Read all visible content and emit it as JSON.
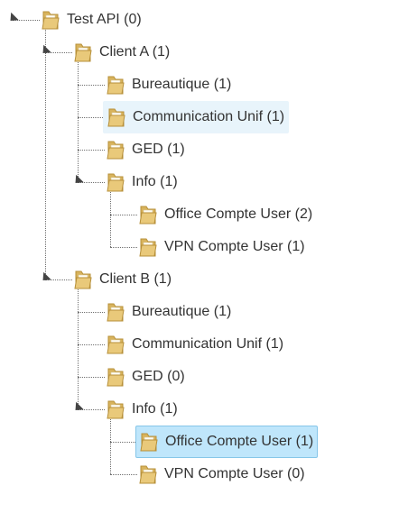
{
  "tree": {
    "label": "Test API (0)",
    "expanded": true,
    "children": [
      {
        "label": "Client A (1)",
        "expanded": true,
        "children": [
          {
            "label": "Bureautique (1)",
            "children": []
          },
          {
            "label": "Communication Unif (1)",
            "state": "hover",
            "children": []
          },
          {
            "label": "GED (1)",
            "children": []
          },
          {
            "label": "Info (1)",
            "expanded": true,
            "children": [
              {
                "label": "Office Compte User (2)",
                "children": []
              },
              {
                "label": "VPN Compte User (1)",
                "children": []
              }
            ]
          }
        ]
      },
      {
        "label": "Client B (1)",
        "expanded": true,
        "children": [
          {
            "label": "Bureautique (1)",
            "children": []
          },
          {
            "label": "Communication Unif (1)",
            "children": []
          },
          {
            "label": "GED (0)",
            "children": []
          },
          {
            "label": "Info (1)",
            "expanded": true,
            "children": [
              {
                "label": "Office Compte User (1)",
                "state": "selected",
                "children": []
              },
              {
                "label": "VPN Compte User (0)",
                "children": []
              }
            ]
          }
        ]
      }
    ]
  },
  "colors": {
    "hover_bg": "#e8f4fb",
    "selected_bg": "#bfe6fb",
    "selected_border": "#86c6e8",
    "folder": "#e9c97a",
    "text": "#333333"
  },
  "icons": {
    "folder": "folder-icon",
    "toggle": "expanded-triangle-icon"
  }
}
